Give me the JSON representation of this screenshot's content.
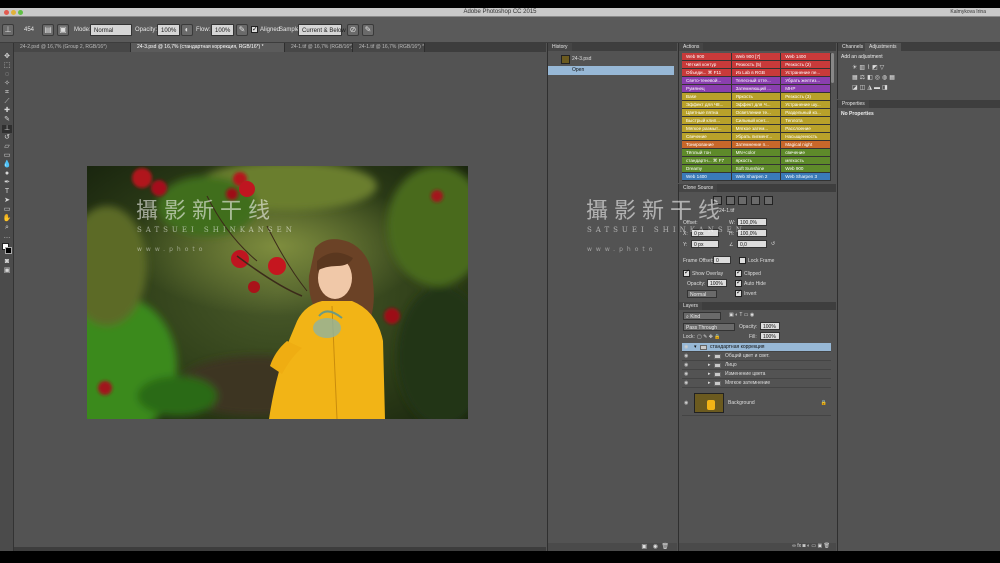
{
  "app": {
    "title": "Adobe Photoshop CC 2015",
    "user": "Kalmykova Irina"
  },
  "options_bar": {
    "brush_size": "454",
    "mode_label": "Mode:",
    "mode_value": "Normal",
    "opacity_label": "Opacity:",
    "opacity_value": "100%",
    "flow_label": "Flow:",
    "flow_value": "100%",
    "aligned_label": "Aligned",
    "sample_label": "Sample:",
    "sample_value": "Current & Below"
  },
  "tabs": [
    {
      "label": "24-2.psd @ 16,7% (Group 2, RGB/16*)",
      "active": false
    },
    {
      "label": "24-3.psd @ 16,7% (стандартная коррекция, RGB/16*) *",
      "active": true
    },
    {
      "label": "24-1.tif @ 16,7% (RGB/16*)",
      "active": false
    },
    {
      "label": "24-1.tif @ 16,7% (RGB/16*) *",
      "active": false
    }
  ],
  "watermark": {
    "chinese": "攝影新干线",
    "latin": "SATSUEI SHINKANSEN",
    "url": "www.photo"
  },
  "history": {
    "panel_title": "History",
    "snapshot": "24-3.psd",
    "steps": [
      {
        "label": "Open",
        "selected": true
      }
    ]
  },
  "actions": {
    "panel_title": "Actions",
    "buttons": [
      {
        "label": "Web 900",
        "color": "#c83a3a"
      },
      {
        "label": "Web 900 [7]",
        "color": "#c83a3a"
      },
      {
        "label": "Web 1400",
        "color": "#c83a3a"
      },
      {
        "label": "Чёткий контур",
        "color": "#c83a3a"
      },
      {
        "label": "Резкость (5)",
        "color": "#c83a3a"
      },
      {
        "label": "Резкость (2)",
        "color": "#c83a3a"
      },
      {
        "label": "Объеди... ⌘ F11",
        "color": "#c83a3a"
      },
      {
        "label": "Из Lab в RGB",
        "color": "#c83a3a"
      },
      {
        "label": "Устранение пе...",
        "color": "#c83a3a"
      },
      {
        "label": "Свето-теневой...",
        "color": "#8a3fae"
      },
      {
        "label": "Телесный отте...",
        "color": "#8a3fae"
      },
      {
        "label": "Убрать желтиз...",
        "color": "#8a3fae"
      },
      {
        "label": "Румянец",
        "color": "#8a3fae"
      },
      {
        "label": "Затемняющий ...",
        "color": "#8a3fae"
      },
      {
        "label": "MHP",
        "color": "#8a3fae"
      },
      {
        "label": "Base",
        "color": "#b8a12a"
      },
      {
        "label": "Яркость",
        "color": "#b8a12a"
      },
      {
        "label": "Резкость (3)",
        "color": "#b8a12a"
      },
      {
        "label": "Эффект для Ч8...",
        "color": "#b8a12a"
      },
      {
        "label": "Эффект для Ч...",
        "color": "#b8a12a"
      },
      {
        "label": "Устранение шу...",
        "color": "#b8a12a"
      },
      {
        "label": "Цветные пятна",
        "color": "#b8a12a"
      },
      {
        "label": "Осветление те...",
        "color": "#b8a12a"
      },
      {
        "label": "Раздельный ко...",
        "color": "#b8a12a"
      },
      {
        "label": "Быстрый клип...",
        "color": "#b8a12a"
      },
      {
        "label": "Сильный конт...",
        "color": "#b8a12a"
      },
      {
        "label": "Теплота",
        "color": "#b8a12a"
      },
      {
        "label": "Мягкое размыт...",
        "color": "#b8a12a"
      },
      {
        "label": "Мягкое затем...",
        "color": "#b8a12a"
      },
      {
        "label": "Расслоение",
        "color": "#b8a12a"
      },
      {
        "label": "Свечение",
        "color": "#b8a12a"
      },
      {
        "label": "Убрать пигмент...",
        "color": "#b8a12a"
      },
      {
        "label": "Насыщенность",
        "color": "#b8a12a"
      },
      {
        "label": "Тонирование",
        "color": "#c8672a"
      },
      {
        "label": "Затемнение п...",
        "color": "#c8672a"
      },
      {
        "label": "Magical night",
        "color": "#c8672a"
      },
      {
        "label": "Тёплый тон",
        "color": "#5e8a2a"
      },
      {
        "label": "MN+color",
        "color": "#5e8a2a"
      },
      {
        "label": "свечение",
        "color": "#5e8a2a"
      },
      {
        "label": "стандартн... ⌘ F7",
        "color": "#5e8a2a"
      },
      {
        "label": "яркость",
        "color": "#5e8a2a"
      },
      {
        "label": "мягкость",
        "color": "#5e8a2a"
      },
      {
        "label": "Dreamy",
        "color": "#5e8a2a"
      },
      {
        "label": "Soft Sunshine",
        "color": "#5e8a2a"
      },
      {
        "label": "Web 900",
        "color": "#5e8a2a"
      },
      {
        "label": "Web 1400",
        "color": "#3a7ab8"
      },
      {
        "label": "Web Sharpen 2",
        "color": "#3a7ab8"
      },
      {
        "label": "Web Sharpen 3",
        "color": "#3a7ab8"
      }
    ]
  },
  "clone_source": {
    "panel_title": "Clone Source",
    "source_name": "24-1.tif",
    "offset_label": "Offset:",
    "x": "0 px",
    "y": "0 px",
    "w": "100,0%",
    "h": "100,0%",
    "angle": "0,0",
    "extra": "0 px",
    "frame_offset_label": "Frame Offset:",
    "frame_offset": "0",
    "lock_frame": "Lock Frame",
    "show_overlay": "Show Overlay",
    "opacity_label": "Opacity:",
    "opacity": "100%",
    "blend": "Normal",
    "clipped": "Clipped",
    "auto_hide": "Auto Hide",
    "invert": "Invert"
  },
  "layers": {
    "panel_title": "Layers",
    "kind": "Kind",
    "blend_mode": "Pass Through",
    "opacity_label": "Opacity:",
    "opacity": "100%",
    "lock_label": "Lock:",
    "fill_label": "Fill:",
    "fill": "100%",
    "items": [
      {
        "name": "стандартная коррекция",
        "type": "group",
        "level": 0,
        "selected": true
      },
      {
        "name": "Общий цвет и свет.",
        "type": "group",
        "level": 1,
        "selected": false
      },
      {
        "name": "Лицо",
        "type": "group",
        "level": 1,
        "selected": false
      },
      {
        "name": "Изменение цвета",
        "type": "group",
        "level": 1,
        "selected": false
      },
      {
        "name": "Мягкое затемнение",
        "type": "group",
        "level": 1,
        "selected": false
      }
    ],
    "background": "Background"
  },
  "adjustments": {
    "tabs": [
      "Channels",
      "Adjustments"
    ],
    "header": "Add an adjustment"
  },
  "properties": {
    "panel_title": "Properties",
    "empty_text": "No Properties"
  },
  "colors": {
    "selection": "#97b8d6",
    "panel": "#535353",
    "coat": "#f2b416"
  }
}
